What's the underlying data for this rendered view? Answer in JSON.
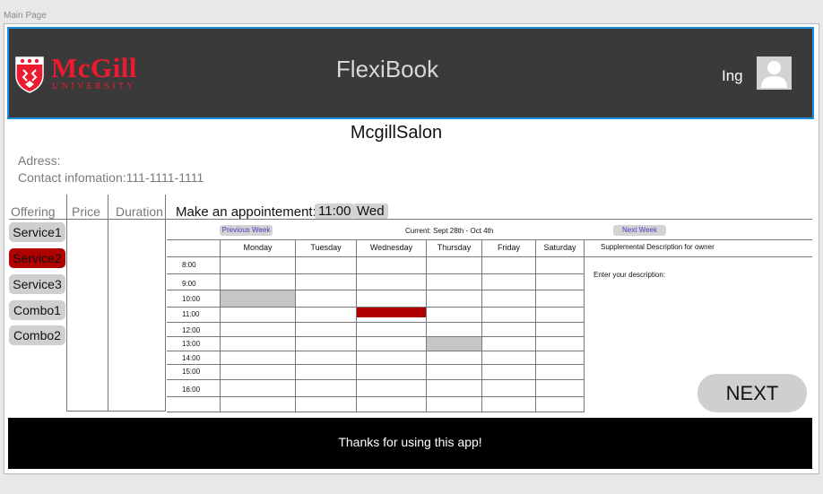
{
  "frame_label": "Main Page",
  "header": {
    "logo_text": "McGill",
    "logo_subtext": "UNIVERSITY",
    "app_title": "FlexiBook",
    "user_name": "Ing"
  },
  "business": {
    "name": "McgillSalon",
    "address_label": "Adress:",
    "contact_label": "Contact infomation:111-1111-1111"
  },
  "services": {
    "headers": {
      "offering": "Offering",
      "price": "Price",
      "duration": "Duration"
    },
    "items": [
      {
        "label": "Service1",
        "selected": false
      },
      {
        "label": "Service2",
        "selected": true
      },
      {
        "label": "Service3",
        "selected": false
      },
      {
        "label": "Combo1",
        "selected": false
      },
      {
        "label": "Combo2",
        "selected": false
      }
    ]
  },
  "appointment": {
    "label": "Make an appointement:",
    "time": "11:00",
    "day": "Wed"
  },
  "calendar": {
    "prev_week": "Previous Week",
    "current_week": "Current: Sept 28th - Oct 4th",
    "next_week": "Next Week",
    "days": [
      "Monday",
      "Tuesday",
      "Wednesday",
      "Thursday",
      "Friday",
      "Saturday"
    ],
    "times": [
      "8:00",
      "9:00",
      "10:00",
      "11:00",
      "12:00",
      "13:00",
      "14:00",
      "15:00",
      "16:00"
    ],
    "booked_color": "#b10000",
    "unavailable_color": "#c6c6c6"
  },
  "supplemental": {
    "title": "Supplemental Description for owner",
    "prompt": "Enter your description:"
  },
  "next_button": "NEXT",
  "footer": "Thanks for using this app!",
  "colors": {
    "header_bg": "#3a3a3a",
    "header_border": "#1b8fe0",
    "brand_red": "#ed1b2f",
    "selected_service": "#b10000",
    "footer_bg": "#000000"
  }
}
